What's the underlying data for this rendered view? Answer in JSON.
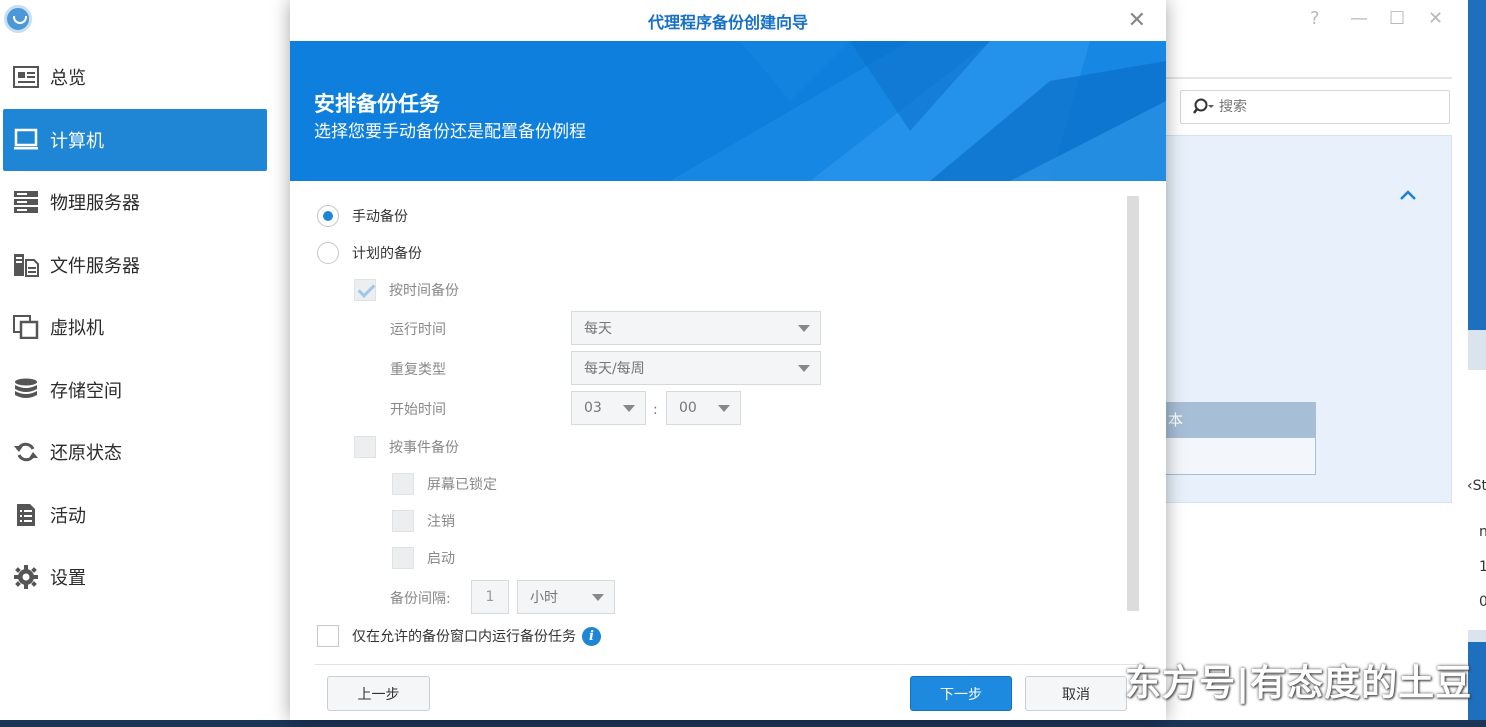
{
  "sidebar": {
    "items": [
      {
        "label": "总览",
        "icon": "overview-icon"
      },
      {
        "label": "计算机",
        "icon": "computer-icon",
        "active": true
      },
      {
        "label": "物理服务器",
        "icon": "server-icon"
      },
      {
        "label": "文件服务器",
        "icon": "file-server-icon"
      },
      {
        "label": "虚拟机",
        "icon": "virtual-machine-icon"
      },
      {
        "label": "存储空间",
        "icon": "storage-icon"
      },
      {
        "label": "还原状态",
        "icon": "restore-icon"
      },
      {
        "label": "活动",
        "icon": "activity-icon"
      },
      {
        "label": "设置",
        "icon": "gear-icon"
      }
    ]
  },
  "window_controls": {
    "help": "?",
    "minimize": "—",
    "maximize": "☐",
    "close": "✕"
  },
  "search": {
    "placeholder": "搜索"
  },
  "background_panel": {
    "column_header": "本"
  },
  "edge_text": [
    "‹St",
    "n",
    "1",
    "0"
  ],
  "dialog": {
    "title": "代理程序备份创建向导",
    "close": "✕",
    "banner_title": "安排备份任务",
    "banner_subtitle": "选择您要手动备份还是配置备份例程",
    "options": {
      "manual": "手动备份",
      "scheduled": "计划的备份",
      "by_time": "按时间备份",
      "run_time_label": "运行时间",
      "run_time_value": "每天",
      "repeat_label": "重复类型",
      "repeat_value": "每天/每周",
      "start_label": "开始时间",
      "start_hour": "03",
      "start_minute": "00",
      "by_event": "按事件备份",
      "screen_locked": "屏幕已锁定",
      "logout": "注销",
      "startup": "启动",
      "interval_label": "备份间隔:",
      "interval_value": "1",
      "interval_unit": "小时",
      "window_only": "仅在允许的备份窗口内运行备份任务"
    },
    "buttons": {
      "prev": "上一步",
      "next": "下一步",
      "cancel": "取消"
    }
  },
  "watermark": "东方号|有态度的土豆",
  "colors": {
    "accent": "#1f86d6",
    "banner": "#0e7fdd"
  }
}
